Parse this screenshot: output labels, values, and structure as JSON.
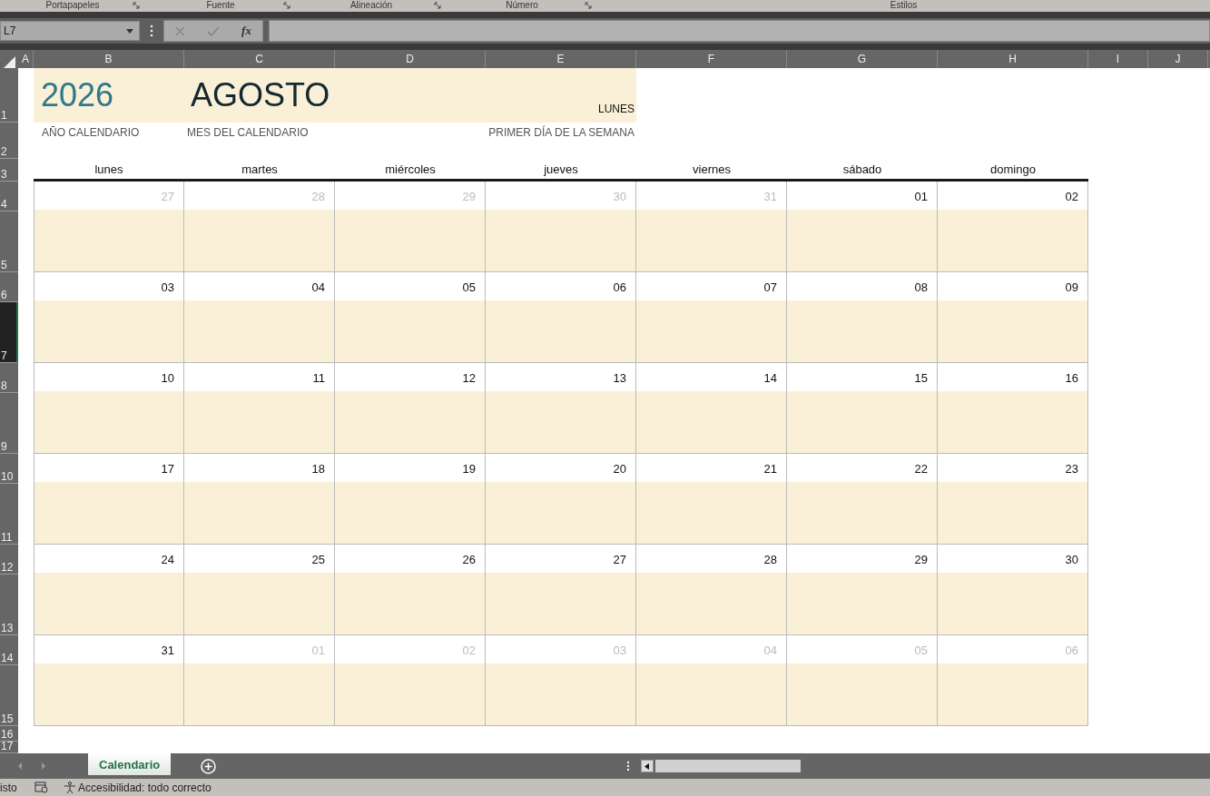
{
  "ribbon_groups": [
    {
      "label": "Portapapeles",
      "launcher": true
    },
    {
      "label": "Fuente",
      "launcher": true
    },
    {
      "label": "Alineación",
      "launcher": true
    },
    {
      "label": "Número",
      "launcher": true
    },
    {
      "label": "Estilos",
      "launcher": false
    }
  ],
  "name_box": {
    "value": "L7"
  },
  "formula_bar": {
    "fx": "fx"
  },
  "columns": [
    {
      "label": "A"
    },
    {
      "label": "B"
    },
    {
      "label": "C"
    },
    {
      "label": "D"
    },
    {
      "label": "E"
    },
    {
      "label": "F"
    },
    {
      "label": "G"
    },
    {
      "label": "H"
    },
    {
      "label": "I"
    },
    {
      "label": "J"
    }
  ],
  "rows": [
    {
      "label": "1",
      "selected": false
    },
    {
      "label": "2",
      "selected": false
    },
    {
      "label": "3",
      "selected": false
    },
    {
      "label": "4",
      "selected": false
    },
    {
      "label": "5",
      "selected": false
    },
    {
      "label": "6",
      "selected": false
    },
    {
      "label": "7",
      "selected": true
    },
    {
      "label": "8",
      "selected": false
    },
    {
      "label": "9",
      "selected": false
    },
    {
      "label": "10",
      "selected": false
    },
    {
      "label": "11",
      "selected": false
    },
    {
      "label": "12",
      "selected": false
    },
    {
      "label": "13",
      "selected": false
    },
    {
      "label": "14",
      "selected": false
    },
    {
      "label": "15",
      "selected": false
    },
    {
      "label": "16",
      "selected": false
    },
    {
      "label": "17",
      "selected": false
    }
  ],
  "header": {
    "year": "2026",
    "year_label": "AÑO CALENDARIO",
    "month": "AGOSTO",
    "month_label": "MES DEL CALENDARIO",
    "first_day": "LUNES",
    "first_day_label": "PRIMER DÍA DE LA SEMANA"
  },
  "weekdays": [
    "lunes",
    "martes",
    "miércoles",
    "jueves",
    "viernes",
    "sábado",
    "domingo"
  ],
  "weeks": [
    [
      {
        "day": "27",
        "in_month": false
      },
      {
        "day": "28",
        "in_month": false
      },
      {
        "day": "29",
        "in_month": false
      },
      {
        "day": "30",
        "in_month": false
      },
      {
        "day": "31",
        "in_month": false
      },
      {
        "day": "01",
        "in_month": true
      },
      {
        "day": "02",
        "in_month": true
      }
    ],
    [
      {
        "day": "03",
        "in_month": true
      },
      {
        "day": "04",
        "in_month": true
      },
      {
        "day": "05",
        "in_month": true
      },
      {
        "day": "06",
        "in_month": true
      },
      {
        "day": "07",
        "in_month": true
      },
      {
        "day": "08",
        "in_month": true
      },
      {
        "day": "09",
        "in_month": true
      }
    ],
    [
      {
        "day": "10",
        "in_month": true
      },
      {
        "day": "11",
        "in_month": true
      },
      {
        "day": "12",
        "in_month": true
      },
      {
        "day": "13",
        "in_month": true
      },
      {
        "day": "14",
        "in_month": true
      },
      {
        "day": "15",
        "in_month": true
      },
      {
        "day": "16",
        "in_month": true
      }
    ],
    [
      {
        "day": "17",
        "in_month": true
      },
      {
        "day": "18",
        "in_month": true
      },
      {
        "day": "19",
        "in_month": true
      },
      {
        "day": "20",
        "in_month": true
      },
      {
        "day": "21",
        "in_month": true
      },
      {
        "day": "22",
        "in_month": true
      },
      {
        "day": "23",
        "in_month": true
      }
    ],
    [
      {
        "day": "24",
        "in_month": true
      },
      {
        "day": "25",
        "in_month": true
      },
      {
        "day": "26",
        "in_month": true
      },
      {
        "day": "27",
        "in_month": true
      },
      {
        "day": "28",
        "in_month": true
      },
      {
        "day": "29",
        "in_month": true
      },
      {
        "day": "30",
        "in_month": true
      }
    ],
    [
      {
        "day": "31",
        "in_month": true
      },
      {
        "day": "01",
        "in_month": false
      },
      {
        "day": "02",
        "in_month": false
      },
      {
        "day": "03",
        "in_month": false
      },
      {
        "day": "04",
        "in_month": false
      },
      {
        "day": "05",
        "in_month": false
      },
      {
        "day": "06",
        "in_month": false
      }
    ]
  ],
  "sheet_tabs": [
    {
      "label": "Calendario",
      "selected": true
    }
  ],
  "status_bar": {
    "mode": "isto",
    "accessibility": "Accesibilidad: todo correcto"
  }
}
